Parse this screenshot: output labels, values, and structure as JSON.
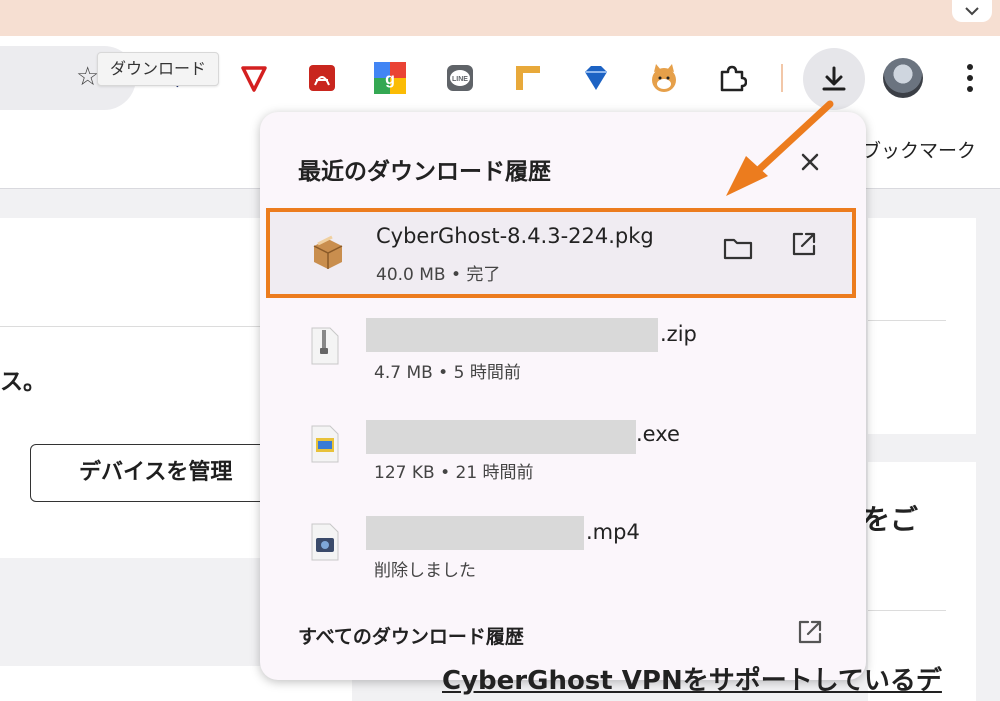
{
  "browser": {
    "tooltip": "ダウンロード",
    "bookmarks_label": "ブックマーク",
    "extensions": [
      "quill-icon",
      "shield-extension-icon",
      "acrobat-icon",
      "google-icon",
      "line-icon",
      "ruler-icon",
      "diamond-icon",
      "shiba-icon",
      "puzzle-icon"
    ]
  },
  "page": {
    "left_text": "ス。",
    "manage_button": "デバイスを管理",
    "right_text": "をご",
    "right_link": "CyberGhost VPNをサポートしているデ"
  },
  "downloads_panel": {
    "title": "最近のダウンロード履歴",
    "items": [
      {
        "name": "CyberGhost-8.4.3-224.pkg",
        "meta": "40.0 MB • 完了",
        "icon": "package-icon",
        "highlighted": true
      },
      {
        "name": ".zip",
        "meta": "4.7 MB • 5 時間前",
        "icon": "zip-file-icon"
      },
      {
        "name": ".exe",
        "meta": "127 KB • 21 時間前",
        "icon": "exe-file-icon"
      },
      {
        "name": ".mp4",
        "meta": "削除しました",
        "icon": "video-file-icon"
      }
    ],
    "footer_label": "すべてのダウンロード履歴"
  },
  "colors": {
    "highlight": "#ec7c1e",
    "arrow": "#ec7c1e",
    "panel_bg": "#fbf6fb",
    "top_strip": "#f6dfd2"
  }
}
